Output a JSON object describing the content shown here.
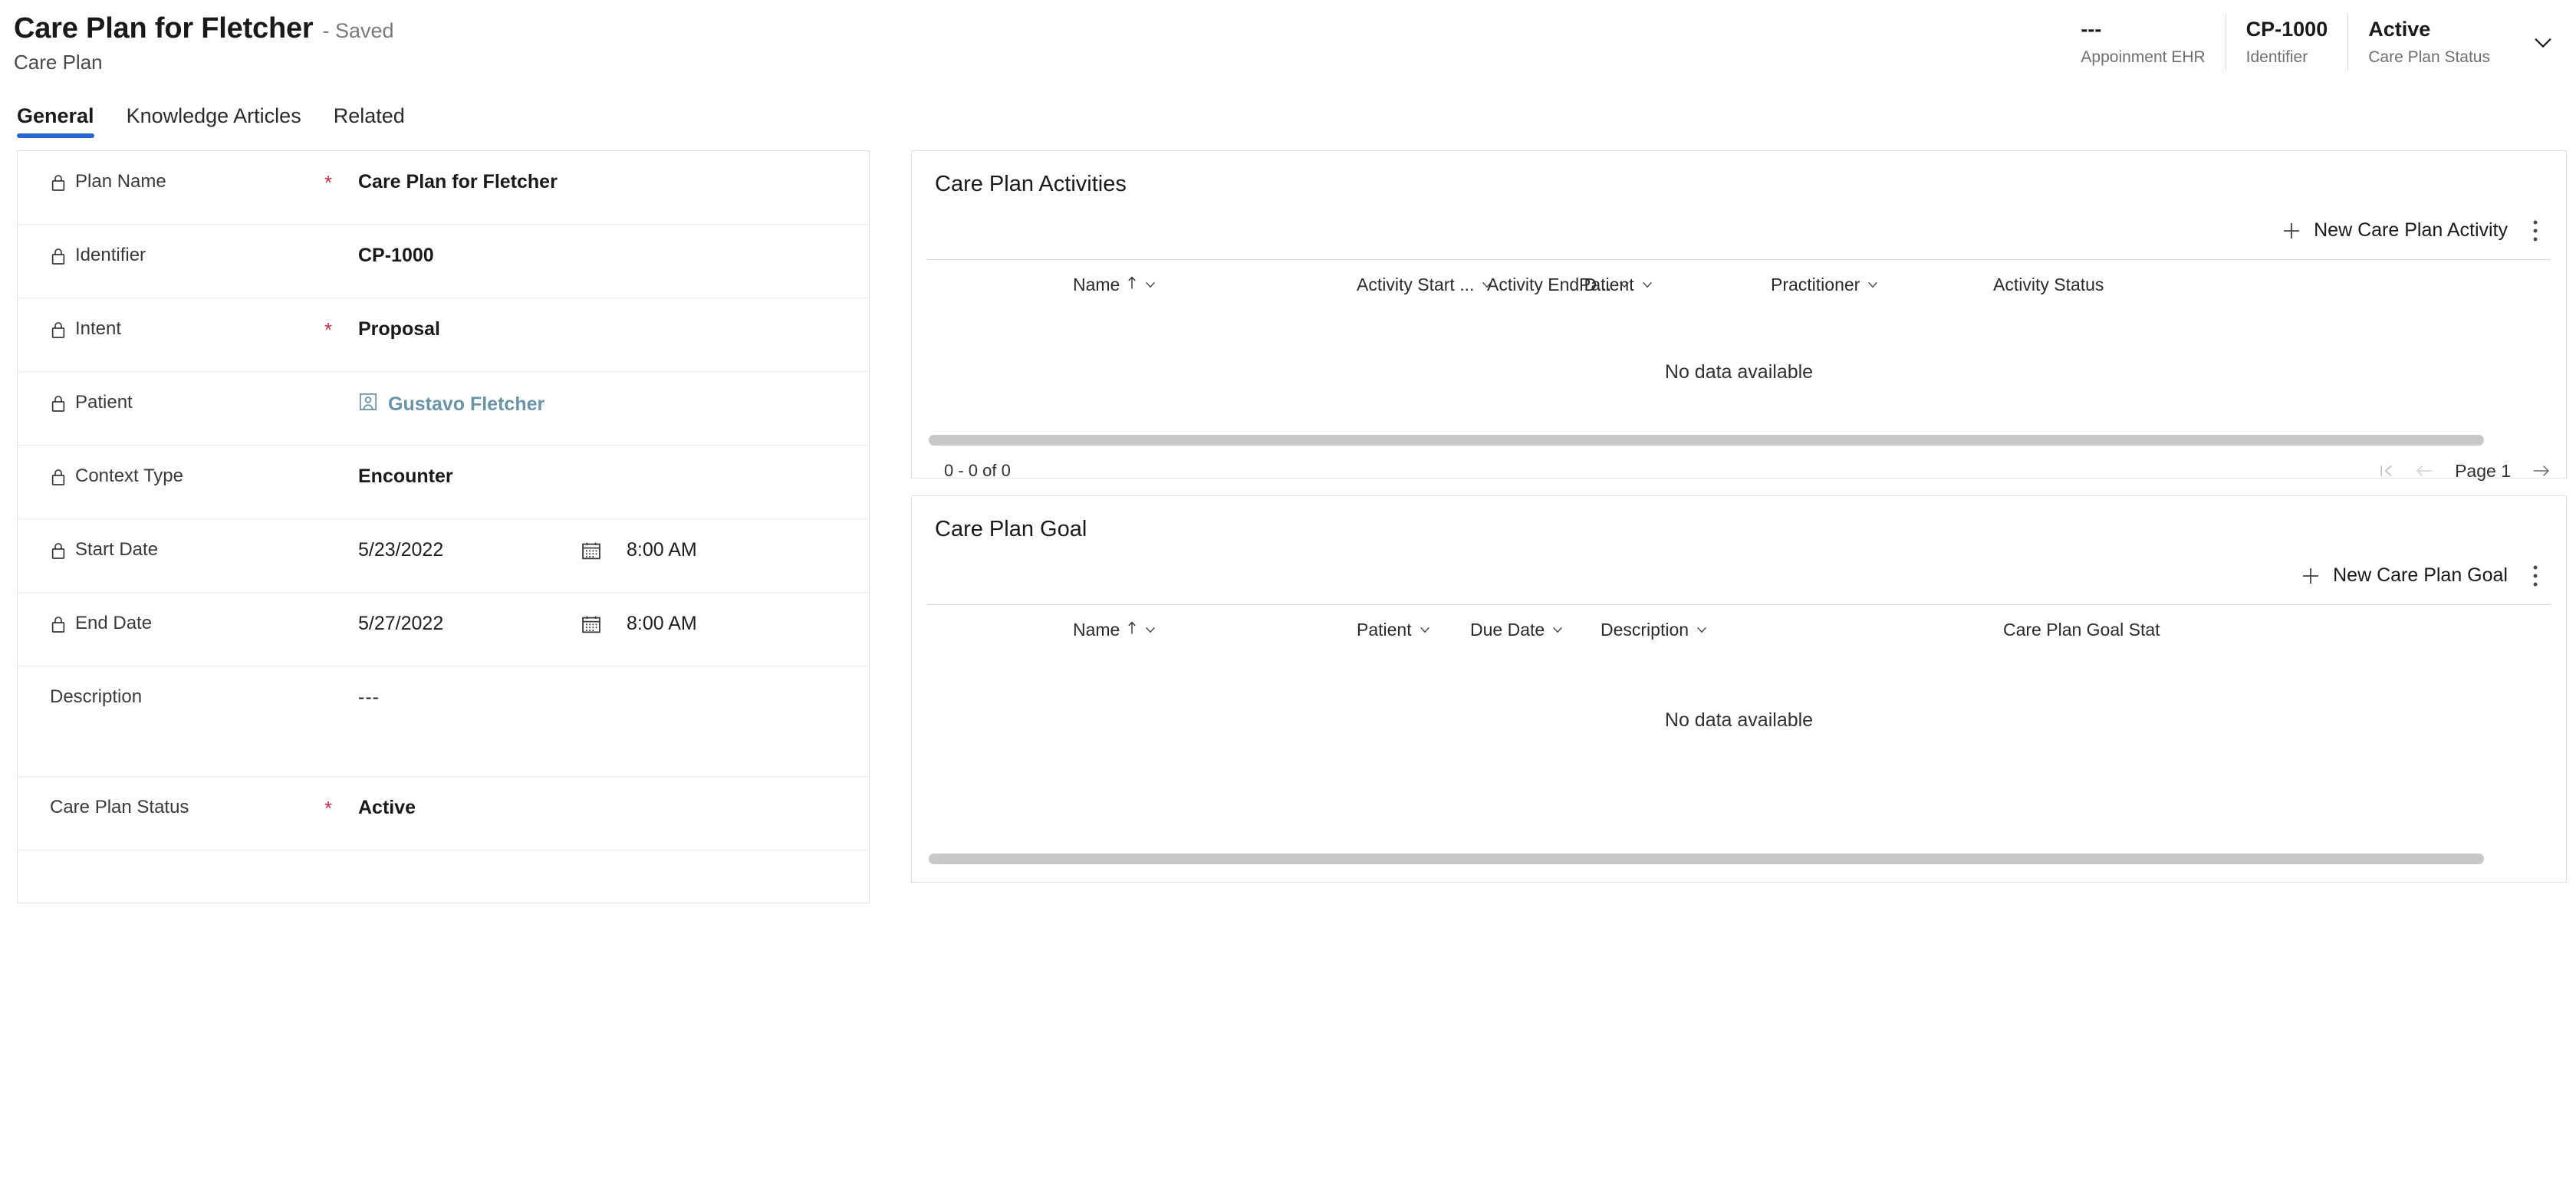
{
  "header": {
    "title": "Care Plan for Fletcher",
    "saved_state": "- Saved",
    "entity": "Care Plan",
    "fields": [
      {
        "value": "---",
        "label": "Appoinment EHR"
      },
      {
        "value": "CP-1000",
        "label": "Identifier"
      },
      {
        "value": "Active",
        "label": "Care Plan Status"
      }
    ],
    "chevron_icon": "chevron-down-icon"
  },
  "tabs": [
    {
      "label": "General",
      "active": true
    },
    {
      "label": "Knowledge Articles",
      "active": false
    },
    {
      "label": "Related",
      "active": false
    }
  ],
  "form": {
    "rows": [
      {
        "label": "Plan Name",
        "locked": true,
        "required": true,
        "value": "Care Plan for Fletcher",
        "style": "strong"
      },
      {
        "label": "Identifier",
        "locked": true,
        "required": false,
        "value": "CP-1000",
        "style": "strong"
      },
      {
        "label": "Intent",
        "locked": true,
        "required": true,
        "value": "Proposal",
        "style": "strong"
      },
      {
        "label": "Patient",
        "locked": true,
        "required": false,
        "value": "Gustavo Fletcher",
        "style": "link"
      },
      {
        "label": "Context Type",
        "locked": true,
        "required": false,
        "value": "Encounter",
        "style": "strong"
      },
      {
        "label": "Start Date",
        "locked": true,
        "required": false,
        "value": "5/23/2022",
        "time": "8:00 AM",
        "style": "date"
      },
      {
        "label": "End Date",
        "locked": true,
        "required": false,
        "value": "5/27/2022",
        "time": "8:00 AM",
        "style": "date"
      },
      {
        "label": "Description",
        "locked": false,
        "required": false,
        "value": "---",
        "style": "muted"
      },
      {
        "label": "Care Plan Status",
        "locked": false,
        "required": true,
        "value": "Active",
        "style": "strong"
      }
    ]
  },
  "activities_panel": {
    "title": "Care Plan Activities",
    "new_button": "New Care Plan Activity",
    "columns": [
      {
        "label": "Name",
        "sorted": true
      },
      {
        "label": "Activity Start ...",
        "sorted": false
      },
      {
        "label": "Activity End D...",
        "sorted": false
      },
      {
        "label": "Patient",
        "sorted": false
      },
      {
        "label": "Practitioner",
        "sorted": false
      },
      {
        "label": "Activity Status",
        "sorted": false,
        "no_chevron": true
      }
    ],
    "empty_text": "No data available",
    "record_count": "0 - 0 of 0",
    "page_label": "Page 1"
  },
  "goal_panel": {
    "title": "Care Plan Goal",
    "new_button": "New Care Plan Goal",
    "columns": [
      {
        "label": "Name",
        "sorted": true
      },
      {
        "label": "Patient",
        "sorted": false
      },
      {
        "label": "Due Date",
        "sorted": false
      },
      {
        "label": "Description",
        "sorted": false
      },
      {
        "label": "Care Plan Goal Stat",
        "sorted": false,
        "no_chevron": true
      }
    ],
    "empty_text": "No data available"
  },
  "colors": {
    "accent": "#2766cc",
    "link": "#6b93a6",
    "required": "#c4314b",
    "border": "#e1e1e1"
  }
}
